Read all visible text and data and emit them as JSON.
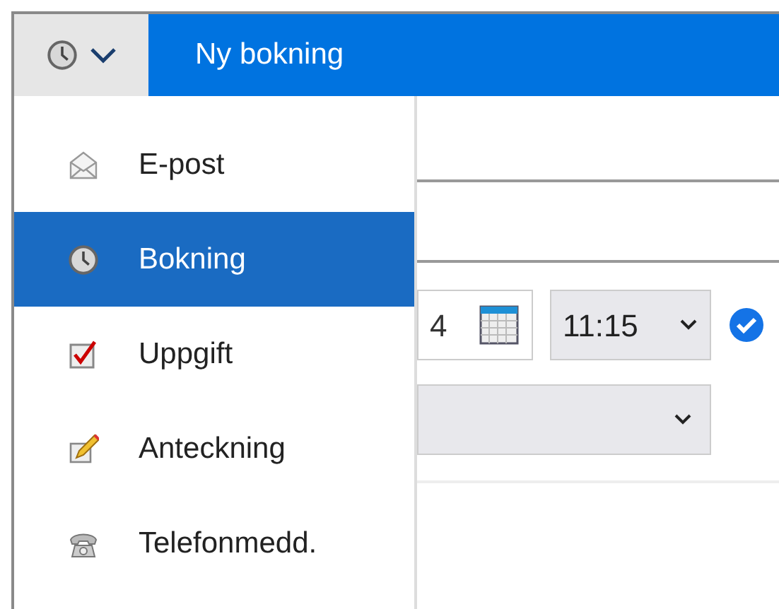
{
  "header": {
    "title": "Ny bokning"
  },
  "menu": [
    {
      "label": "E-post",
      "kind": "mail",
      "selected": false
    },
    {
      "label": "Bokning",
      "kind": "clock",
      "selected": true
    },
    {
      "label": "Uppgift",
      "kind": "task",
      "selected": false
    },
    {
      "label": "Anteckning",
      "kind": "note",
      "selected": false
    },
    {
      "label": "Telefonmedd.",
      "kind": "phone",
      "selected": false
    }
  ],
  "form": {
    "date_value": "4",
    "time_value": "11:15",
    "confirmed": true
  }
}
